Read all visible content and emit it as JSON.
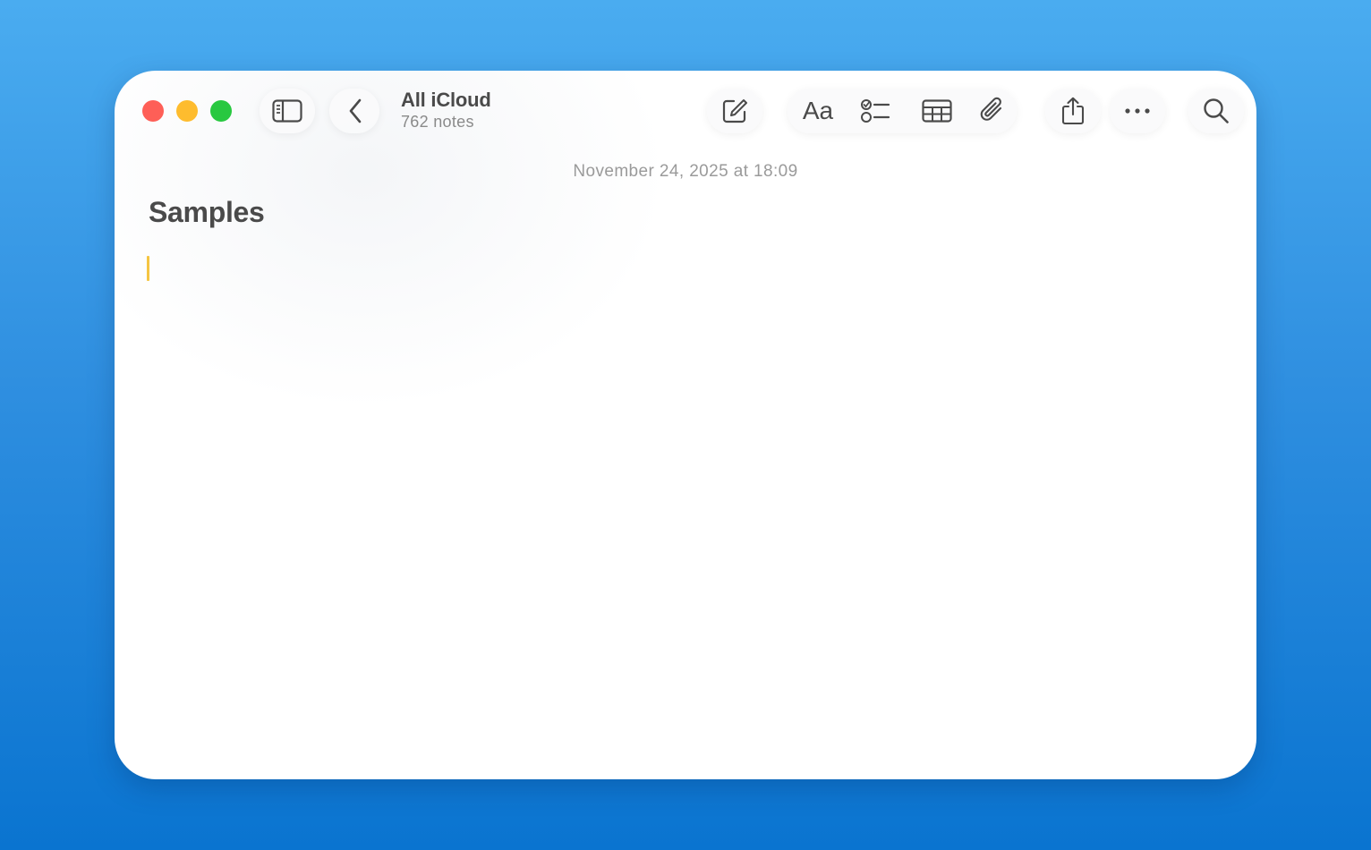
{
  "window": {
    "folder_title": "All iCloud",
    "folder_count": "762 notes"
  },
  "note": {
    "date": "November 24, 2025 at 18:09",
    "title": "Samples"
  },
  "toolbar": {
    "icons": [
      "sidebar-toggle-icon",
      "chevron-left-icon",
      "compose-icon",
      "format-text-icon",
      "checklist-icon",
      "table-icon",
      "paperclip-icon",
      "share-icon",
      "more-icon",
      "search-icon"
    ],
    "format_label": "Aa"
  },
  "colors": {
    "close": "#fe5f57",
    "minimize": "#febc2e",
    "zoom": "#28c840",
    "caret": "#f5c542"
  }
}
